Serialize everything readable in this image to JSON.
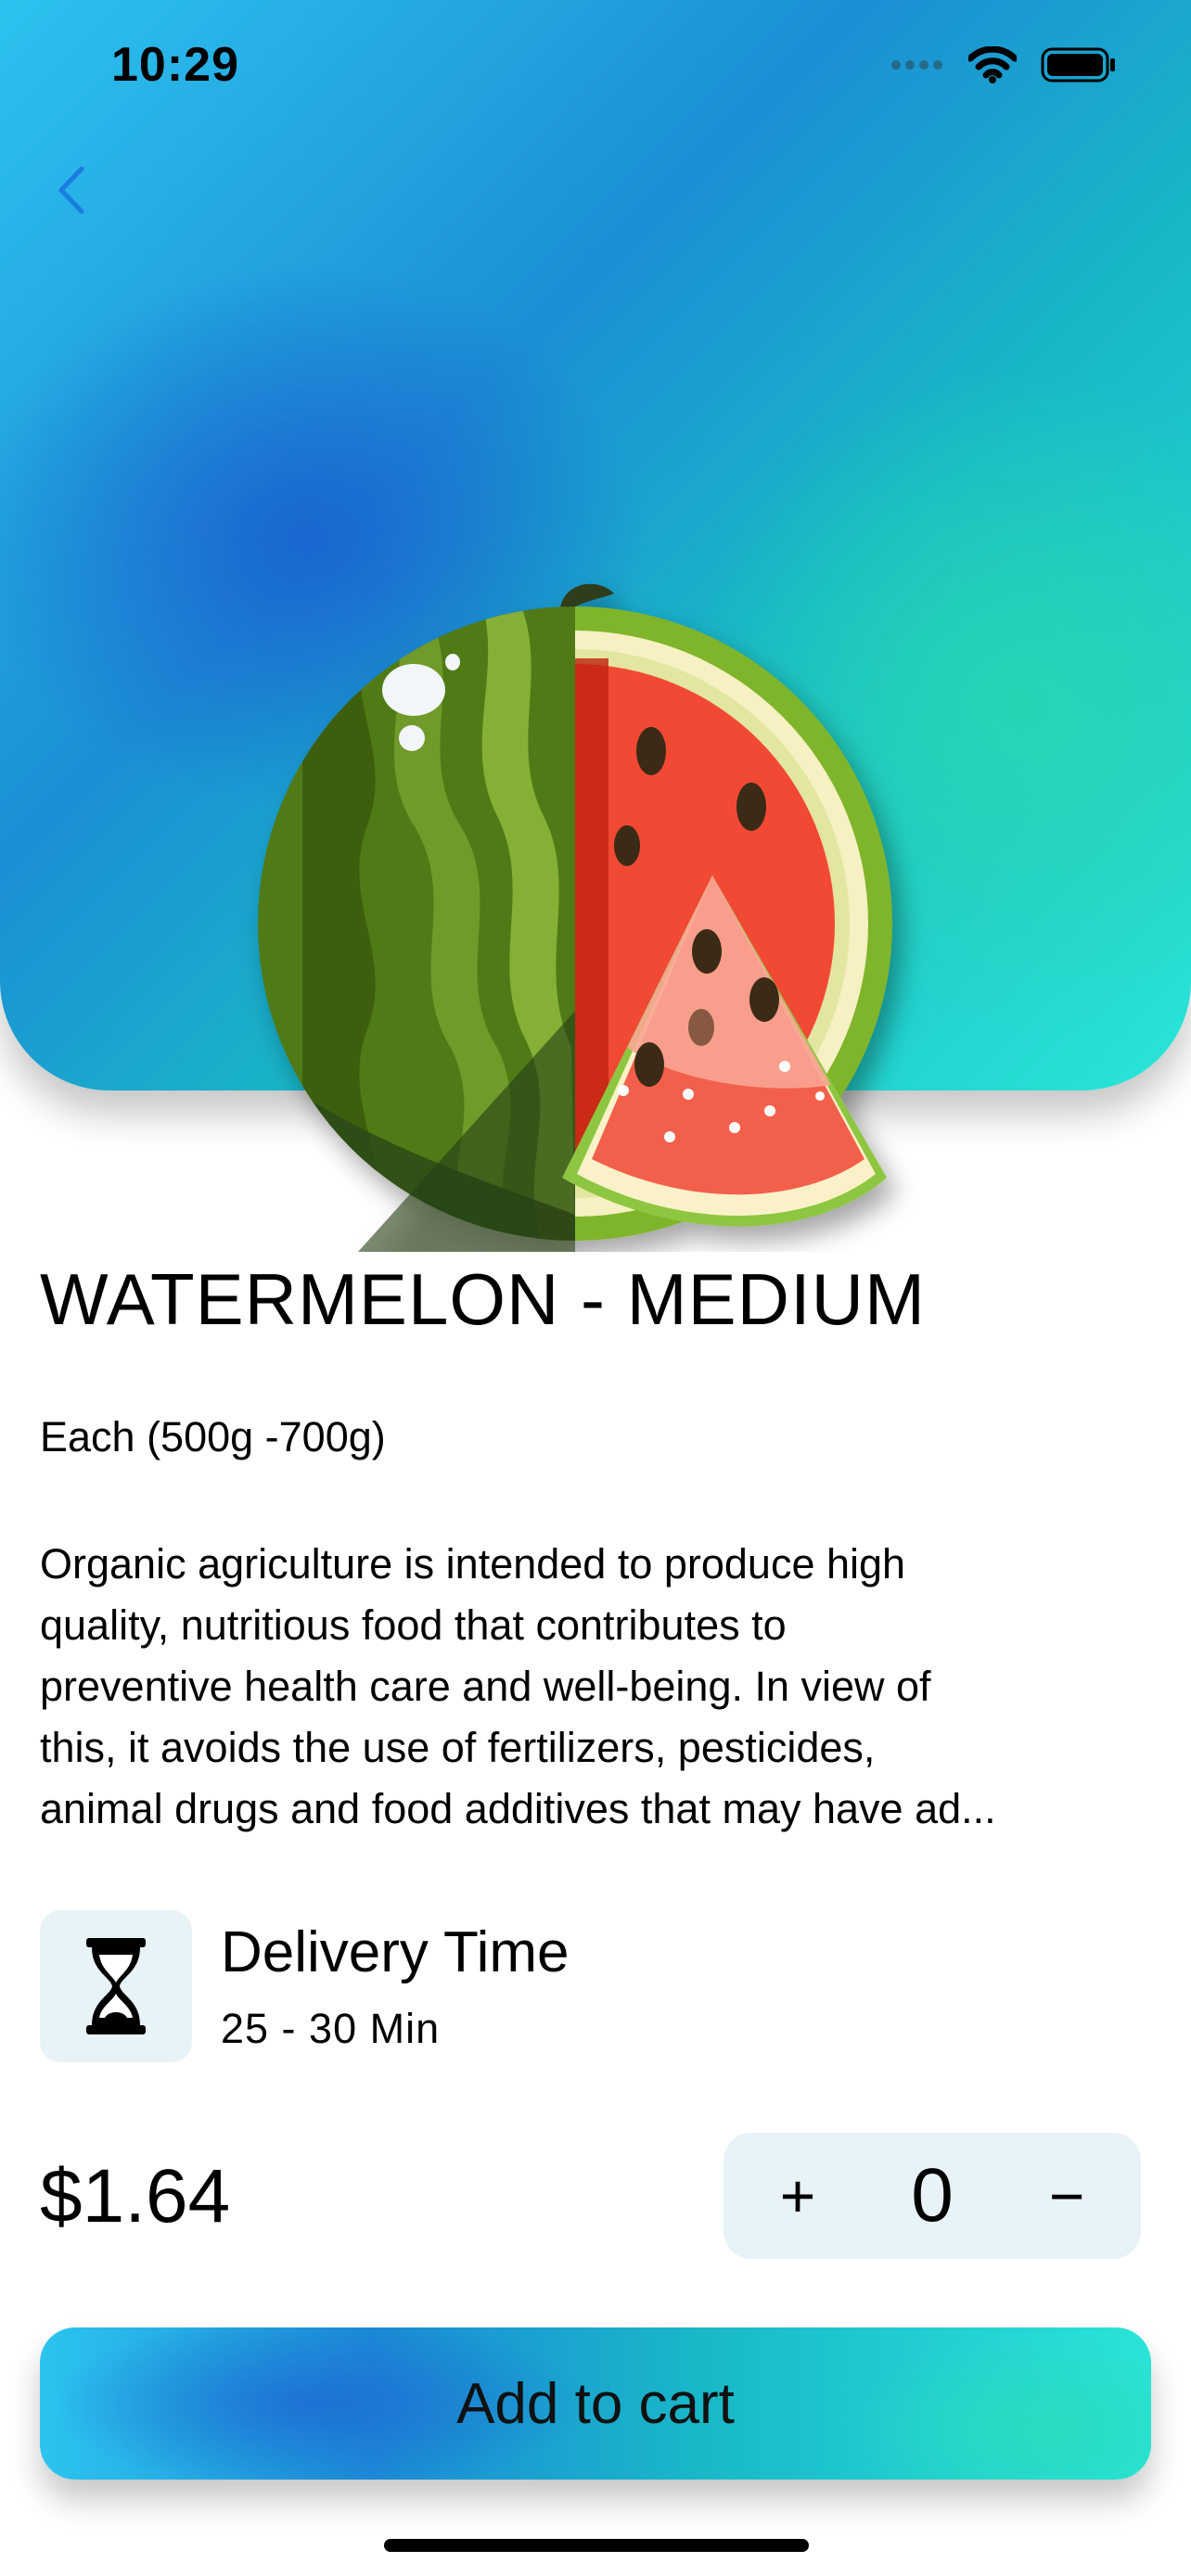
{
  "status_bar": {
    "time": "10:29"
  },
  "product": {
    "title": "WATERMELON - MEDIUM",
    "unit": "Each (500g -700g)",
    "description": "Organic agriculture is intended to produce high\nquality, nutritious food that contributes to\npreventive health care and well-being. In view of\nthis, it avoids the use of fertilizers, pesticides,\nanimal drugs and food additives that may have ad..."
  },
  "delivery": {
    "title": "Delivery Time",
    "value": "25 - 30 Min"
  },
  "price": "$1.64",
  "stepper": {
    "plus": "+",
    "quantity": "0",
    "minus": "−"
  },
  "cart_button": {
    "label": "Add to cart"
  },
  "colors": {
    "gradient_start": "#2cc2ee",
    "gradient_mid": "#1c8fd6",
    "gradient_end": "#29e6d7",
    "back_arrow": "#1a7be0",
    "chip_background": "#e8f3f7"
  },
  "icons": [
    "back-chevron-icon",
    "signal-icon",
    "wifi-icon",
    "battery-icon",
    "hourglass-icon",
    "watermelon-image"
  ]
}
